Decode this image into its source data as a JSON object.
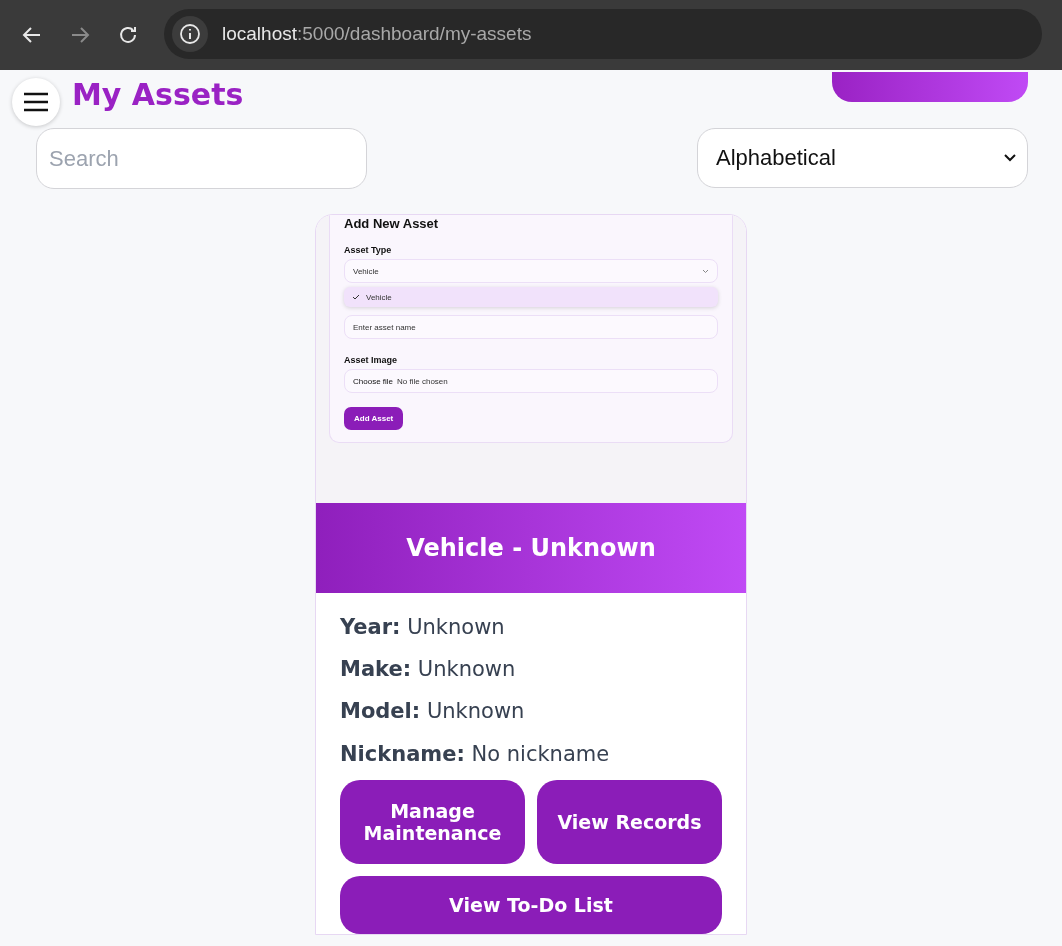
{
  "browser": {
    "url_host": "localhost",
    "url_path": ":5000/dashboard/my-assets"
  },
  "page": {
    "title": "My Assets"
  },
  "search": {
    "placeholder": "Search"
  },
  "sort": {
    "value": "Alphabetical"
  },
  "asset_card": {
    "preview": {
      "title": "Add New Asset",
      "type_label": "Asset Type",
      "type_value": "Vehicle",
      "options": [
        {
          "label": "Vehicle",
          "selected": true
        }
      ],
      "name_placeholder": "Enter asset name",
      "image_label": "Asset Image",
      "file_button": "Choose file",
      "file_status": "No file chosen",
      "submit": "Add Asset"
    },
    "title": "Vehicle - Unknown",
    "fields": [
      {
        "label": "Year:",
        "value": "Unknown"
      },
      {
        "label": "Make:",
        "value": "Unknown"
      },
      {
        "label": "Model:",
        "value": "Unknown"
      },
      {
        "label": "Nickname:",
        "value": "No nickname"
      }
    ],
    "buttons": [
      "Manage Maintenance",
      "View Records"
    ],
    "wide_button": "View To-Do List"
  }
}
